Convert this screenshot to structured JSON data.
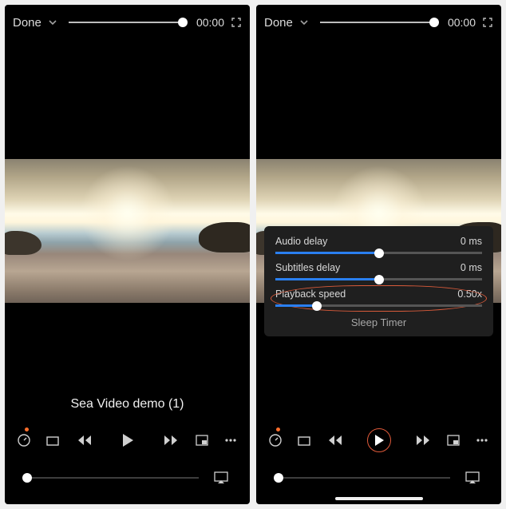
{
  "left": {
    "done": "Done",
    "time": "00:00",
    "title": "Sea Video demo (1)"
  },
  "right": {
    "done": "Done",
    "time": "00:00",
    "panel": {
      "audio_delay_label": "Audio delay",
      "audio_delay_value": "0 ms",
      "audio_delay_pct": 50,
      "subs_delay_label": "Subtitles delay",
      "subs_delay_value": "0 ms",
      "subs_delay_pct": 50,
      "speed_label": "Playback speed",
      "speed_value": "0.50x",
      "speed_pct": 20,
      "sleep_label": "Sleep Timer"
    }
  }
}
